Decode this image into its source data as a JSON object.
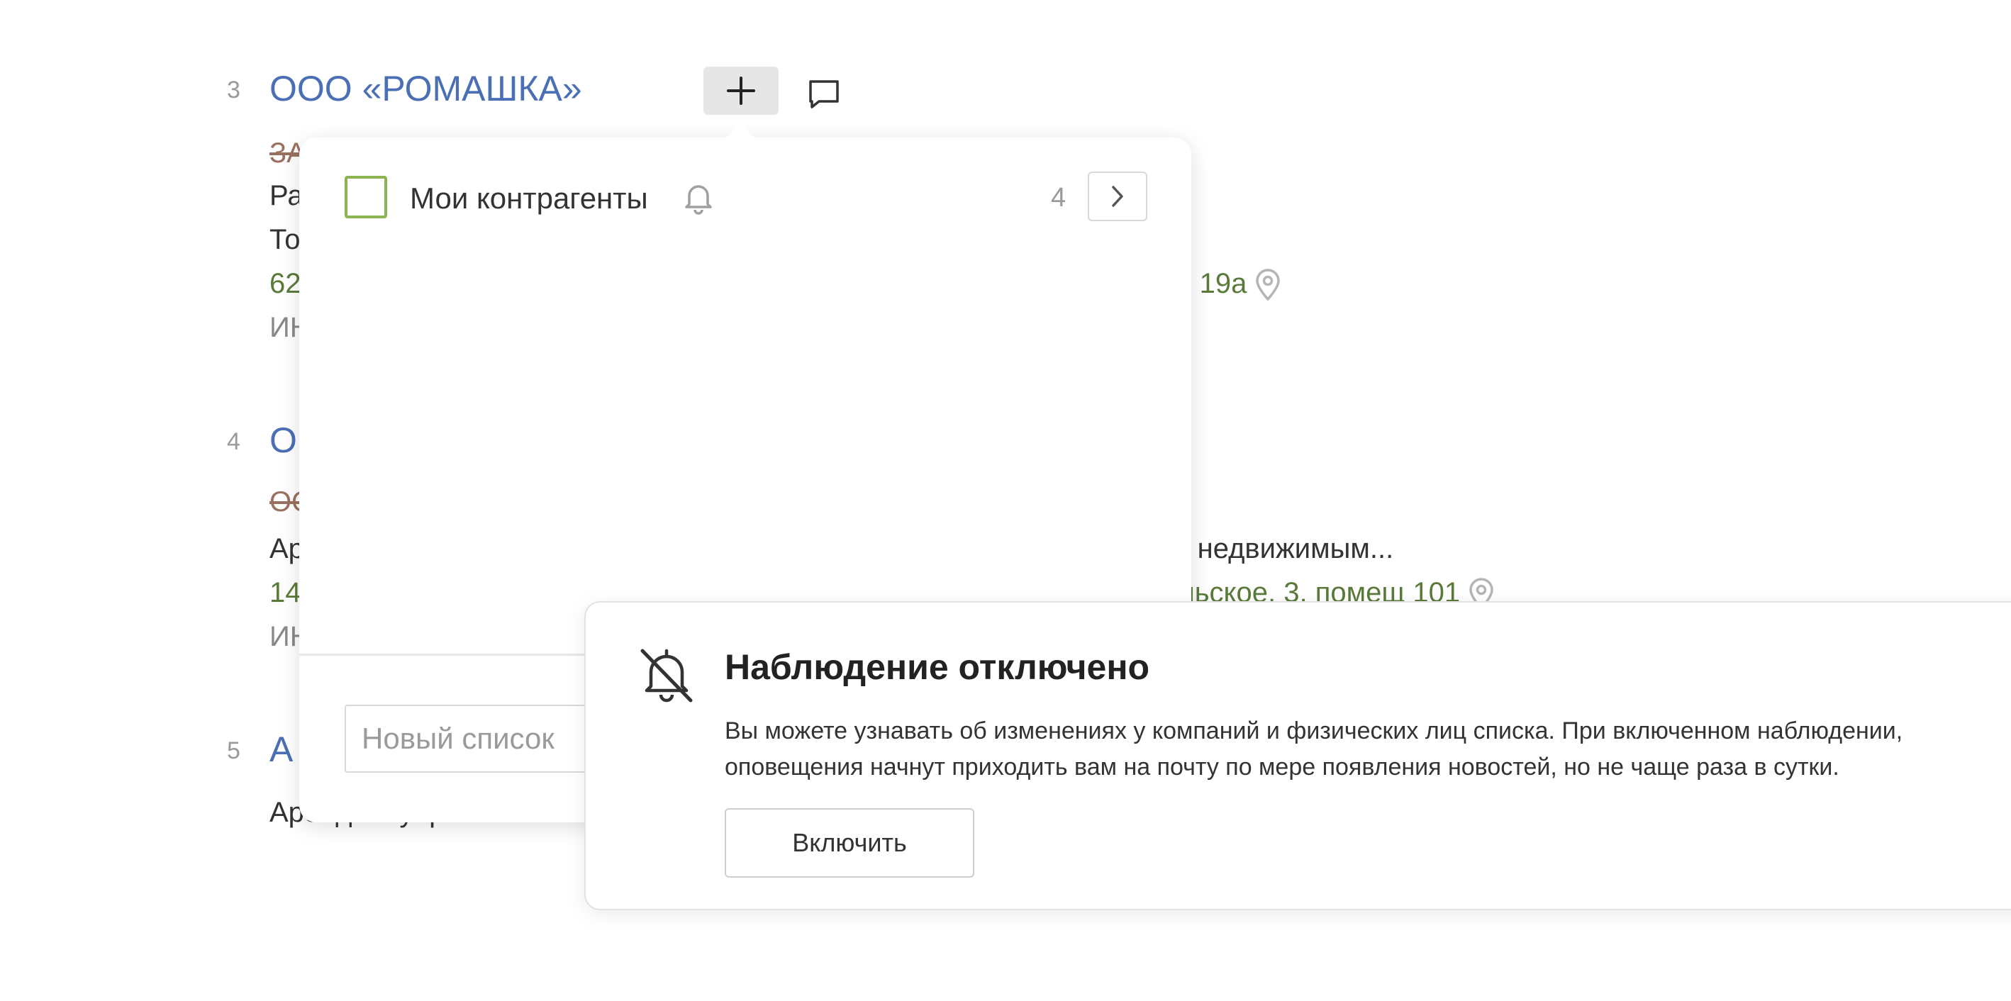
{
  "results": [
    {
      "number": "3",
      "name": "ООО «РОМАШКА»",
      "former_name": "ЗА",
      "activity": "Ра",
      "director": "То",
      "address_start": "62",
      "address_end": "тр 19а",
      "inn": "ИН"
    },
    {
      "number": "4",
      "name": "О",
      "former_name": "ОО",
      "activity_start": "Ар",
      "activity_end": "м недвижимым...",
      "address_start": "14",
      "address_end": "ольское, 3, помещ 101",
      "inn": "ИН"
    },
    {
      "number": "5",
      "name": "А",
      "activity": "Аренда и управление"
    }
  ],
  "lists_popup": {
    "list_name": "Мои контрагенты",
    "count": "4",
    "new_list_placeholder": "Новый список"
  },
  "watch_notice": {
    "title": "Наблюдение отключено",
    "text": "Вы можете узнавать об изменениях у компаний и физических лиц списка. При включенном наблюдении, оповещения начнут приходить вам на почту по мере появления новостей, но не чаще раза в сутки.",
    "enable_label": "Включить"
  },
  "icons": {
    "add": "plus-icon",
    "comment": "comment-icon",
    "location": "map-pin-icon",
    "watch": "bell-icon",
    "watch_off": "bell-off-icon",
    "open": "chevron-right-icon"
  },
  "colors": {
    "link": "#4a6fb5",
    "address": "#5a7a3a",
    "checkbox_border": "#8db452"
  }
}
